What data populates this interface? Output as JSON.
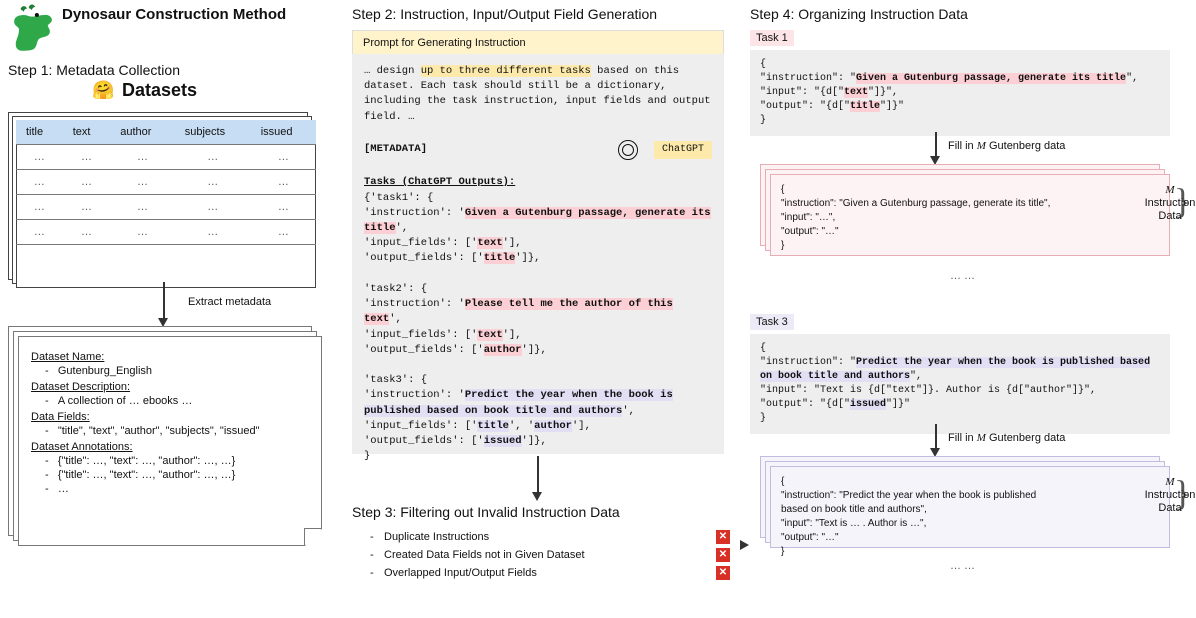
{
  "header": {
    "title": "Dynosaur Construction Method"
  },
  "steps": {
    "s1": "Step 1: Metadata Collection",
    "s2": "Step 2: Instruction, Input/Output Field Generation",
    "s3": "Step 3: Filtering out Invalid Instruction Data",
    "s4": "Step 4: Organizing Instruction Data"
  },
  "datasets": {
    "word": "Datasets"
  },
  "table": {
    "cols": [
      "title",
      "text",
      "author",
      "subjects",
      "issued"
    ],
    "cell": "…"
  },
  "extract": "Extract metadata",
  "metadata_card": {
    "name_label": "Dataset Name:",
    "name_val": "Gutenburg_English",
    "desc_label": "Dataset Description:",
    "desc_val": "A collection of … ebooks …",
    "fields_label": "Data Fields:",
    "fields_val": "\"title\", \"text\", \"author\", \"subjects\", \"issued\"",
    "ann_label": "Dataset Annotations:",
    "ann1": "{\"title\": …, \"text\": …, \"author\": …, …}",
    "ann2": "{\"title\": …, \"text\": …, \"author\": …, …}",
    "ann3": "…"
  },
  "prompt_header": "Prompt for Generating Instruction",
  "prompt_body_pre": "… design ",
  "prompt_body_hl": "up to three different tasks",
  "prompt_body_post": " based on this dataset. Each task should still be a dictionary, including the task instruction, input fields and output field. …",
  "metadata_tag": "[METADATA]",
  "chatgpt": "ChatGPT",
  "tasks_heading": "Tasks (ChatGPT Outputs):",
  "task1": {
    "open": "{'task1': {",
    "instr_key": "    'instruction': '",
    "instr": "Given a Gutenburg passage, generate its title",
    "instr_close": "',",
    "in": "    'input_fields': ['",
    "in_val": "text",
    "in_close": "'],",
    "out": "    'output_fields': ['",
    "out_val": "title",
    "out_close": "']},"
  },
  "task2": {
    "open": " 'task2': {",
    "instr_key": "    'instruction': '",
    "instr": "Please tell me the author of this text",
    "instr_close": "',",
    "in": "    'input_fields': ['",
    "in_val": "text",
    "in_close": "'],",
    "out": "    'output_fields': ['",
    "out_val": "author",
    "out_close": "']},"
  },
  "task3": {
    "open": " 'task3': {",
    "instr_key": "    'instruction': '",
    "instr": "Predict the year when the book is published based on book title and authors",
    "instr_close": "',",
    "in_a": "    'input_fields': ['",
    "in_val_a": "title",
    "in_mid": "', '",
    "in_val_b": "author",
    "in_close": "'],",
    "out": "    'output_fields': ['",
    "out_val": "issued",
    "out_close": "']},",
    "close": "}"
  },
  "step3_items": [
    "Duplicate Instructions",
    "Created Data Fields not in Given Dataset",
    "Overlapped Input/Output Fields"
  ],
  "s4": {
    "task1_lbl": "Task 1",
    "task3_lbl": "Task 3",
    "t1_open": "{",
    "t1_instr_key": "  \"instruction\": \"",
    "t1_instr": "Given a Gutenburg passage, generate its title",
    "t1_instr_close": "\",",
    "t1_input": "  \"input\": \"{d[\"",
    "t1_input_f": "text",
    "t1_input_close": "\"]}\",",
    "t1_output": "  \"output\": \"{d[\"",
    "t1_output_f": "title",
    "t1_output_close": "\"]}\"",
    "brace_close": "}",
    "fill_pre": "Fill in ",
    "fill_post": " Gutenberg data",
    "card_t1_l1": "{",
    "card_t1_l2": "  \"instruction\": \"Given a Gutenburg passage, generate its title\",",
    "card_t1_l3": "  \"input\": \"…\",",
    "card_t1_l4": "  \"output\": \"…\"",
    "card_t1_l5": "}",
    "m_label": "Instruction\nData",
    "t3_instr_key": "  \"instruction\": \"",
    "t3_instr": "Predict the year when the book is published based on book title and authors",
    "t3_instr_close": "\",",
    "t3_input_full": "  \"input\": \"Text is {d[\"text\"]}. Author is {d[\"author\"]}\",",
    "t3_output": "  \"output\": \"{d[\"",
    "t3_output_f": "issued",
    "t3_output_close": "\"]}\"",
    "card_t3_l2a": "  \"instruction\": \"Predict the year when the book is published",
    "card_t3_l2b": "based on book title and authors\",",
    "card_t3_l3": "  \"input\": \"Text is … . Author is …\",",
    "card_t3_l4": "  \"output\": \"…\"",
    "dots": "…  …"
  }
}
